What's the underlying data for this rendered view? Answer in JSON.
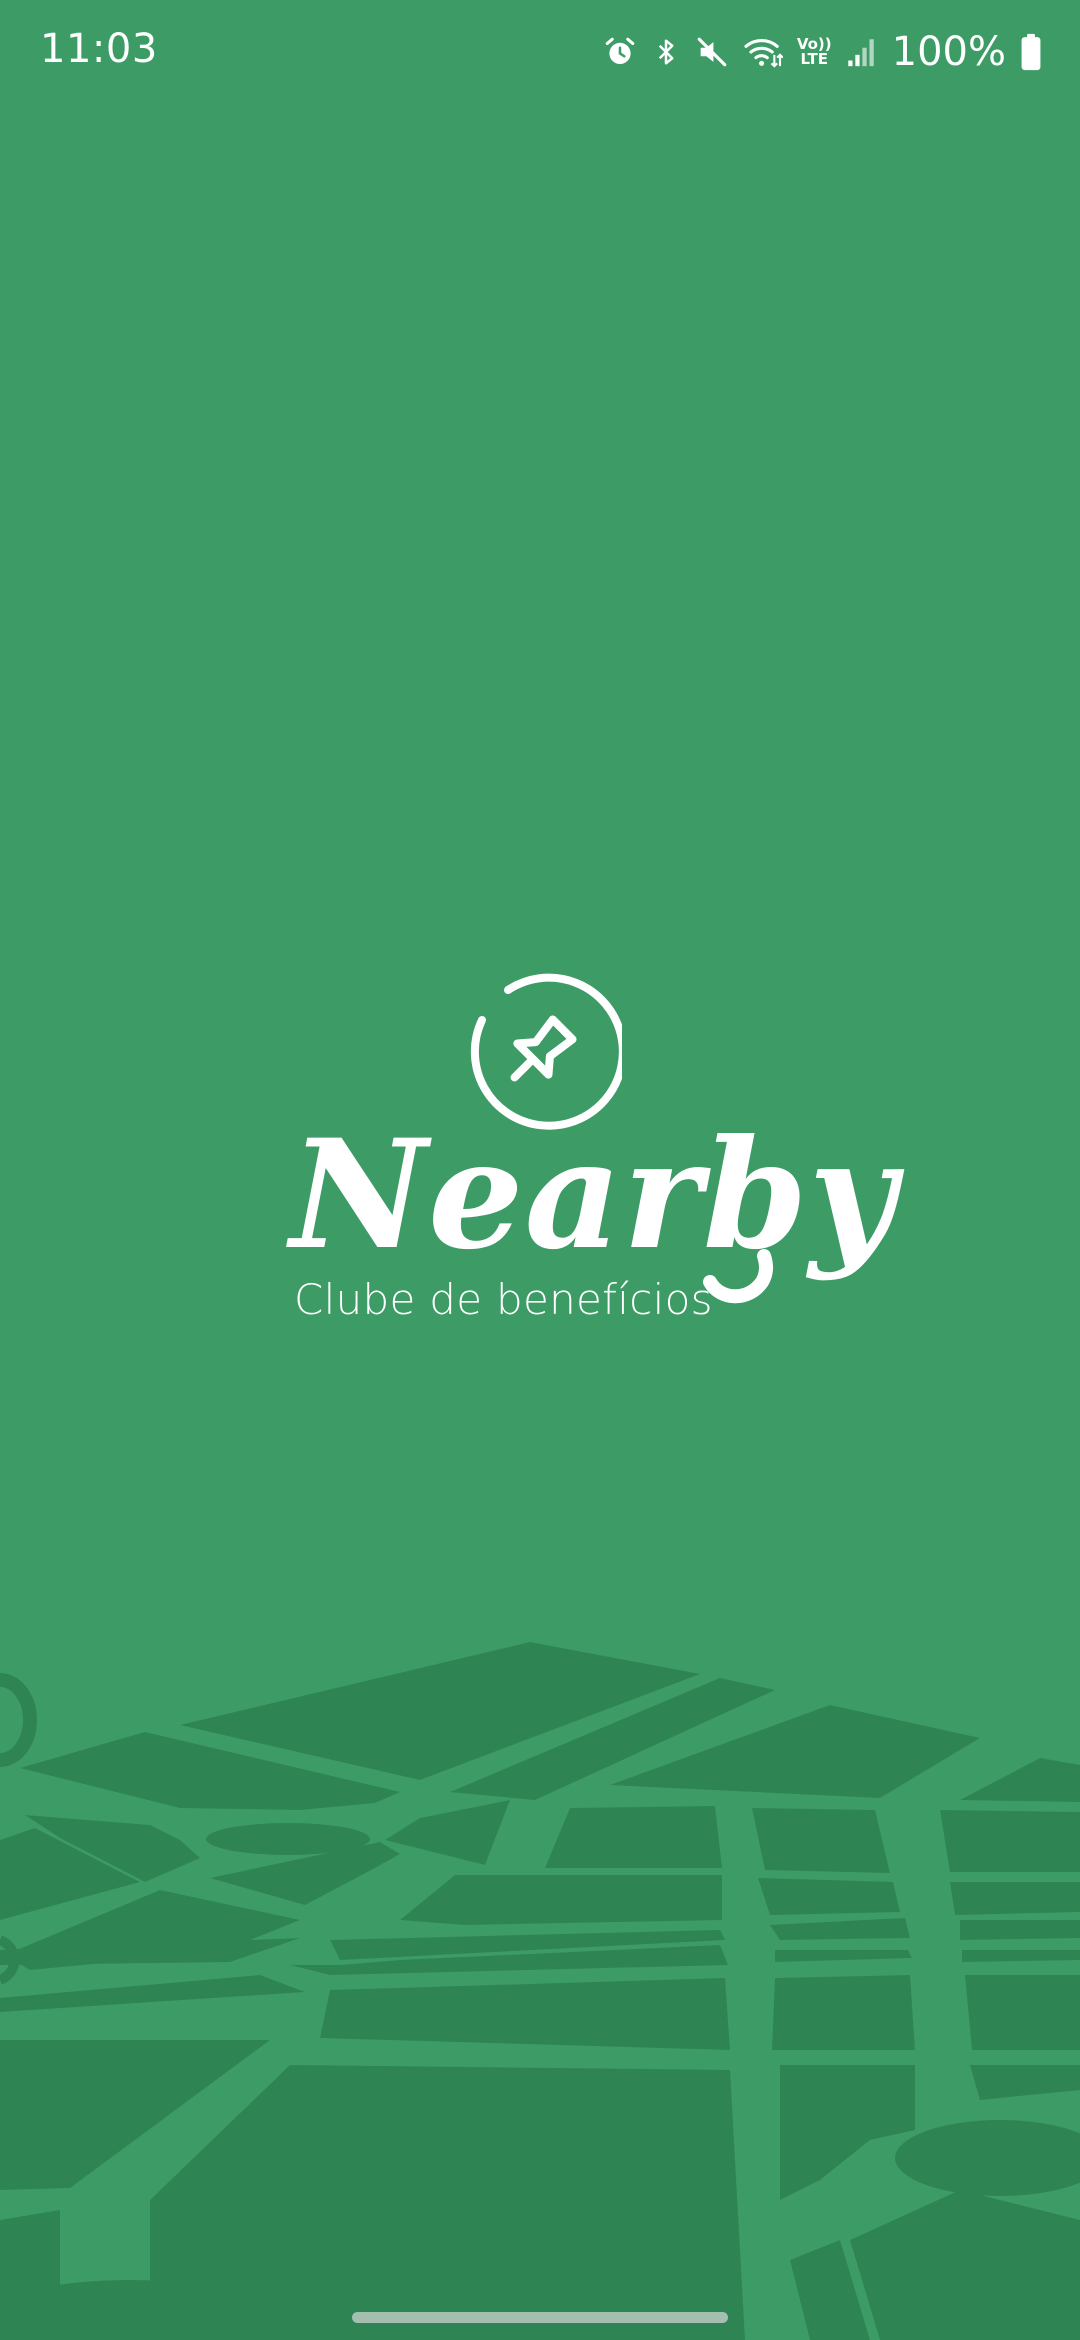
{
  "status_bar": {
    "time": "11:03",
    "battery_percent": "100%",
    "network_label_top": "Vo))",
    "network_label_bottom": "LTE",
    "icons": [
      "alarm-icon",
      "bluetooth-icon",
      "mute-icon",
      "wifi-icon",
      "volte-icon",
      "cell-signal-icon",
      "battery-icon"
    ]
  },
  "splash": {
    "brand_name": "Nearby",
    "tagline": "Clube de benefícios",
    "logo_icon": "pushpin-in-circle-icon"
  },
  "colors": {
    "background": "#3d9c66",
    "map_blocks": "#2e8553",
    "foreground": "#ffffff"
  }
}
